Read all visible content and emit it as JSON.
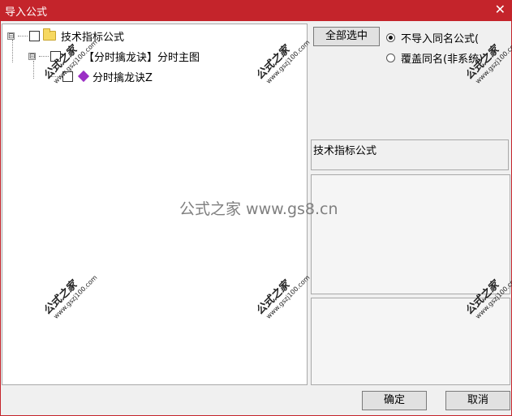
{
  "window": {
    "title": "导入公式"
  },
  "tree": {
    "root": {
      "label": "技术指标公式",
      "expander": "⊟"
    },
    "group": {
      "label": "【分时擒龙诀】分时主图",
      "expander": "⊟"
    },
    "leaf": {
      "label": "分时擒龙诀Z"
    }
  },
  "options": {
    "select_all_label": "全部选中",
    "radio_skip_label": "不导入同名公式(",
    "radio_overwrite_label": "覆盖同名(非系统)",
    "selected_radio": "skip"
  },
  "info": {
    "category_label": "技术指标公式"
  },
  "buttons": {
    "ok_label": "确定",
    "cancel_label": "取消"
  },
  "watermarks": {
    "center": "公式之家 www.gs8.cn",
    "diag_main": "公式之家",
    "diag_url": "www.gszj100.com"
  }
}
